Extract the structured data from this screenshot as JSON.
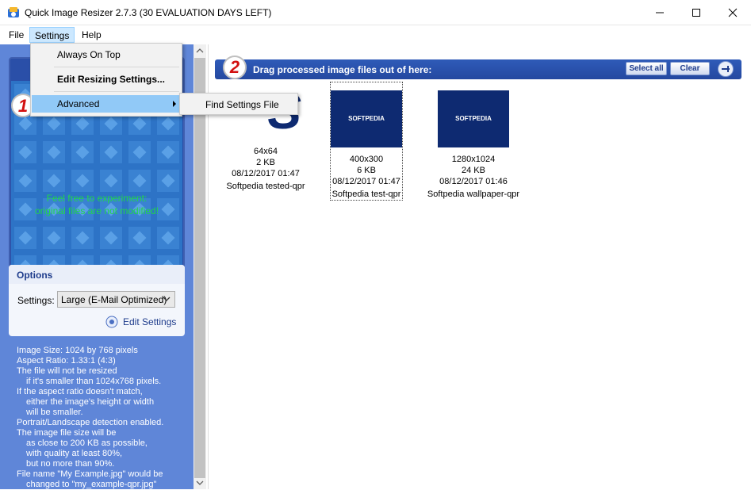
{
  "window": {
    "title": "Quick Image Resizer 2.7.3 (30 EVALUATION DAYS LEFT)",
    "minimize_icon": "minimize-icon",
    "maximize_icon": "maximize-icon",
    "close_icon": "close-icon"
  },
  "menubar": {
    "items": [
      {
        "label": "File"
      },
      {
        "label": "Settings"
      },
      {
        "label": "Help"
      }
    ]
  },
  "settings_menu": {
    "items": [
      {
        "label": "Always On Top"
      },
      {
        "label": "Edit Resizing Settings..."
      },
      {
        "label": "Advanced"
      }
    ],
    "submenu": {
      "label": "Find Settings File"
    }
  },
  "step1": {
    "number": "1",
    "message_line1": "Feel free to experiment:",
    "message_line2": "original files are not modified!"
  },
  "options": {
    "title": "Options",
    "settings_label": "Settings:",
    "settings_value": "Large (E-Mail Optimized)",
    "edit_settings": "Edit Settings"
  },
  "info": [
    {
      "text": "Image Size: 1024 by 768 pixels",
      "indent": false
    },
    {
      "text": "Aspect Ratio: 1.33:1 (4:3)",
      "indent": false
    },
    {
      "text": "The file will not be resized",
      "indent": false
    },
    {
      "text": "if it's smaller than 1024x768 pixels.",
      "indent": true
    },
    {
      "text": "If the aspect ratio doesn't match,",
      "indent": false
    },
    {
      "text": "either the image's height or width",
      "indent": true
    },
    {
      "text": "will be smaller.",
      "indent": true
    },
    {
      "text": "Portrait/Landscape detection enabled.",
      "indent": false
    },
    {
      "text": "The image file size will be",
      "indent": false
    },
    {
      "text": "as close to 200 KB as possible,",
      "indent": true
    },
    {
      "text": "with quality at least 80%,",
      "indent": true
    },
    {
      "text": "but no more than 90%.",
      "indent": true
    },
    {
      "text": "File name \"My Example.jpg\" would be",
      "indent": false
    },
    {
      "text": "changed to \"my_example-qpr.jpg\"",
      "indent": true
    }
  ],
  "step2": {
    "number": "2",
    "caption": "Drag processed image files out of here:",
    "select_all": "Select all",
    "clear": "Clear"
  },
  "files": [
    {
      "dims": "64x64",
      "size": "2 KB",
      "date": "08/12/2017 01:47",
      "name": "Softpedia tested-qpr",
      "thumb_text": "S"
    },
    {
      "dims": "400x300",
      "size": "6 KB",
      "date": "08/12/2017 01:47",
      "name": "Softpedia test-qpr",
      "thumb_text": "SOFTPEDIA"
    },
    {
      "dims": "1280x1024",
      "size": "24 KB",
      "date": "08/12/2017 01:46",
      "name": "Softpedia wallpaper-qpr",
      "thumb_text": "SOFTPEDIA"
    }
  ],
  "watermark": "SOFTPEDIA",
  "colors": {
    "panel_blue": "#5f86d8",
    "banner_blue": "#2448a0",
    "message_green": "#21d64b",
    "step_red": "#d21010"
  }
}
